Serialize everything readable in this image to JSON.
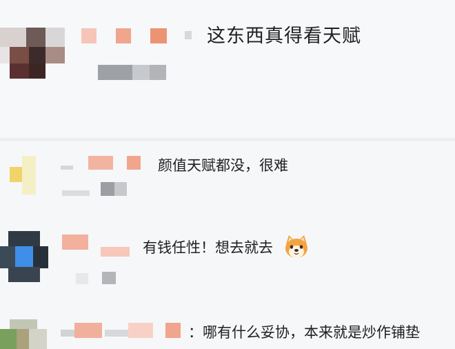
{
  "comments": [
    {
      "text": "这东西真得看天赋"
    },
    {
      "text": "颜值天赋都没，很难"
    },
    {
      "text": "有钱任性！想去就去"
    },
    {
      "text": "：哪有什么妥协，本来就是炒作铺垫"
    }
  ],
  "colors": {
    "background": "#eef0f3",
    "card": "#f6f7f9",
    "text": "#1f1f1f",
    "redacted_username": "#f2a48c",
    "redacted_meta": "#b9bcc2"
  },
  "icons": {
    "comment_3_emoji": "shiba-dog-face-emoji"
  }
}
